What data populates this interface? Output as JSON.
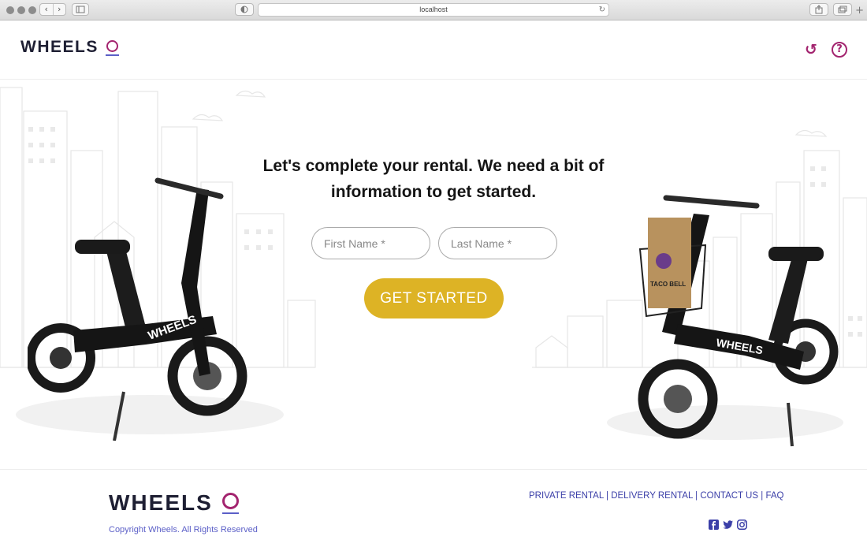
{
  "browser": {
    "url": "localhost",
    "back_glyph": "‹",
    "forward_glyph": "›",
    "reload_glyph": "↻",
    "new_tab_glyph": "+"
  },
  "brand": {
    "name": "WHEELS",
    "accent_color": "#a3246f",
    "underline_color": "#5b5fc7"
  },
  "header": {
    "undo_icon": "undo-icon",
    "undo_glyph": "↺",
    "help_icon": "help-icon",
    "help_glyph": "?"
  },
  "hero": {
    "title": "Let's complete your rental. We need a bit of information to get started.",
    "first_name_placeholder": "First Name *",
    "last_name_placeholder": "Last Name *",
    "cta_label": "GET STARTED",
    "cta_color": "#ddb325",
    "left_bike_label": "WHEELS",
    "right_bike_label": "WHEELS",
    "basket_label": "TACO BELL"
  },
  "footer": {
    "copyright": "Copyright Wheels. All Rights Reserved",
    "links": [
      "PRIVATE RENTAL",
      "DELIVERY RENTAL",
      "CONTACT US",
      "FAQ"
    ],
    "separator": " | ",
    "social_icons": [
      "facebook-icon",
      "twitter-icon",
      "instagram-icon"
    ]
  }
}
